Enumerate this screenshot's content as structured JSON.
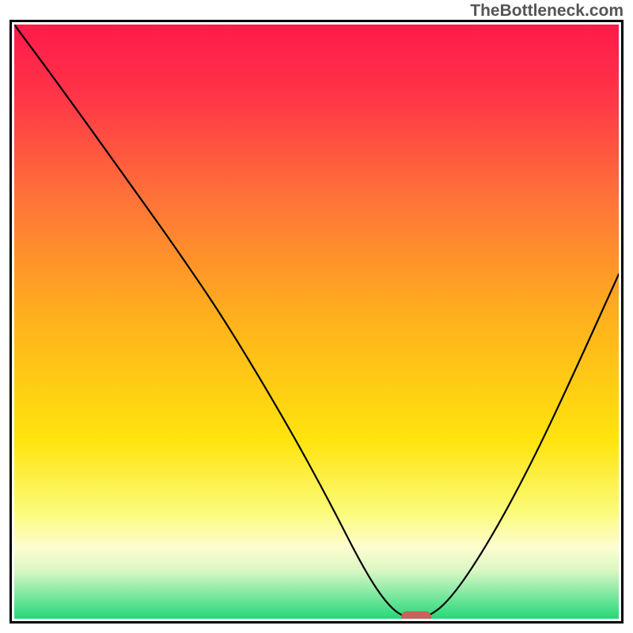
{
  "watermark": "TheBottleneck.com",
  "chart_data": {
    "type": "line",
    "title": "",
    "xlabel": "",
    "ylabel": "",
    "xlim": [
      0,
      100
    ],
    "ylim": [
      0,
      100
    ],
    "grid": false,
    "legend": false,
    "series": [
      {
        "name": "bottleneck-curve",
        "x": [
          0,
          8,
          20,
          27,
          35,
          45,
          52,
          58,
          62,
          65,
          68,
          72,
          78,
          85,
          92,
          100
        ],
        "y": [
          100,
          89,
          72,
          62,
          50,
          33,
          20,
          8,
          2,
          0,
          0,
          3,
          12,
          25,
          40,
          58
        ]
      }
    ],
    "marker": {
      "name": "optimal-point",
      "x": 66.5,
      "y": 0,
      "width_pct": 5,
      "height_pct": 2,
      "color": "#c5635e"
    },
    "background_gradient": {
      "stops": [
        {
          "offset": 0.0,
          "color": "#ff1a4b"
        },
        {
          "offset": 0.12,
          "color": "#ff3547"
        },
        {
          "offset": 0.3,
          "color": "#ff7538"
        },
        {
          "offset": 0.5,
          "color": "#ffb21c"
        },
        {
          "offset": 0.7,
          "color": "#ffe40d"
        },
        {
          "offset": 0.82,
          "color": "#fbfb7a"
        },
        {
          "offset": 0.88,
          "color": "#fdfdd0"
        },
        {
          "offset": 0.92,
          "color": "#d8f7c2"
        },
        {
          "offset": 0.96,
          "color": "#7de8a0"
        },
        {
          "offset": 1.0,
          "color": "#25d879"
        }
      ]
    }
  }
}
